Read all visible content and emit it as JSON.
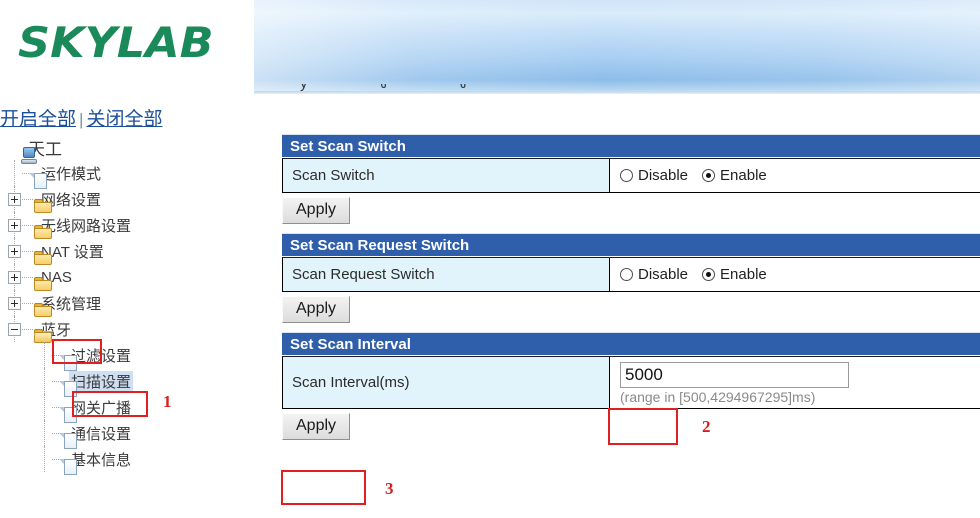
{
  "brand": {
    "logo_text": "SKYLAB"
  },
  "sidebar": {
    "links": {
      "expand_all": "开启全部",
      "separator": "|",
      "collapse_all": "关闭全部"
    },
    "tree": [
      {
        "label": "天工",
        "level": 0,
        "icon": "computer-icon",
        "expander": "none",
        "selected": false
      },
      {
        "label": "运作模式",
        "level": 1,
        "icon": "page-icon",
        "expander": "none",
        "selected": false
      },
      {
        "label": "网络设置",
        "level": 1,
        "icon": "folder-icon",
        "expander": "plus",
        "selected": false
      },
      {
        "label": "无线网路设置",
        "level": 1,
        "icon": "folder-icon",
        "expander": "plus",
        "selected": false
      },
      {
        "label": "NAT 设置",
        "level": 1,
        "icon": "folder-icon",
        "expander": "plus",
        "selected": false
      },
      {
        "label": "NAS",
        "level": 1,
        "icon": "folder-icon",
        "expander": "plus",
        "selected": false
      },
      {
        "label": "系统管理",
        "level": 1,
        "icon": "folder-icon",
        "expander": "plus",
        "selected": false
      },
      {
        "label": "蓝牙",
        "level": 1,
        "icon": "folder-open-icon",
        "expander": "minus",
        "selected": false
      },
      {
        "label": "过滤设置",
        "level": 2,
        "icon": "page-icon",
        "expander": "none",
        "selected": false
      },
      {
        "label": "扫描设置",
        "level": 2,
        "icon": "page-icon",
        "expander": "none",
        "selected": true
      },
      {
        "label": "网关广播",
        "level": 2,
        "icon": "page-icon",
        "expander": "none",
        "selected": false
      },
      {
        "label": "通信设置",
        "level": 2,
        "icon": "page-icon",
        "expander": "none",
        "selected": false
      },
      {
        "label": "基本信息",
        "level": 2,
        "icon": "page-icon",
        "expander": "none",
        "selected": false
      }
    ]
  },
  "main": {
    "sections": [
      {
        "header": "Set Scan Switch",
        "label": "Scan Switch",
        "radios": [
          {
            "label": "Disable",
            "selected": false
          },
          {
            "label": "Enable",
            "selected": true
          }
        ],
        "apply_label": "Apply"
      },
      {
        "header": "Set Scan Request Switch",
        "label": "Scan Request Switch",
        "radios": [
          {
            "label": "Disable",
            "selected": false
          },
          {
            "label": "Enable",
            "selected": true
          }
        ],
        "apply_label": "Apply"
      },
      {
        "header": "Set Scan Interval",
        "label": "Scan Interval(ms)",
        "input_value": "5000",
        "hint": "(range in [500,4294967295]ms)",
        "apply_label": "Apply"
      }
    ]
  },
  "annotations": {
    "markers": [
      {
        "number": "1",
        "target": "sidebar-scan-settings"
      },
      {
        "number": "2",
        "target": "scan-interval-input"
      },
      {
        "number": "3",
        "target": "scan-interval-apply-button"
      }
    ],
    "color": "#d81f1f"
  }
}
